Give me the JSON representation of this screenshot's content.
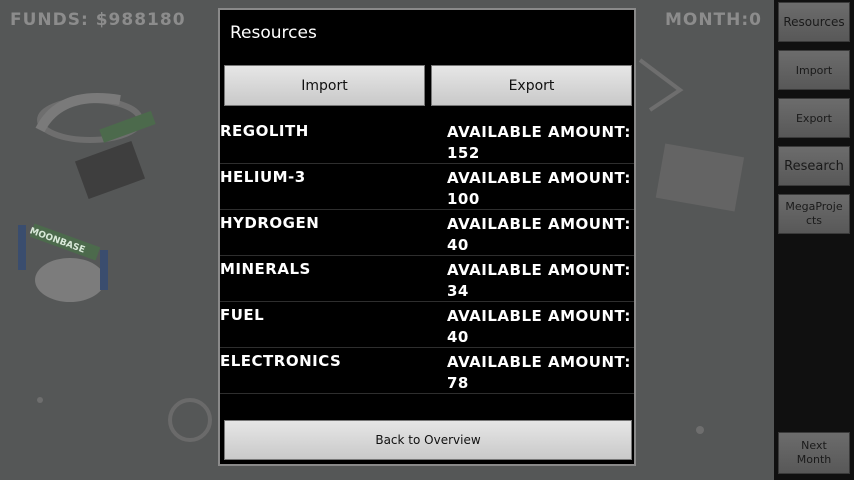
{
  "hud": {
    "funds": "FUNDS: $988180",
    "month": "MONTH:0"
  },
  "sidebar": {
    "resources": "Resources",
    "import": "Import",
    "export": "Export",
    "research": "Research",
    "megaprojects": "MegaProje\ncts",
    "next_month": "Next\nMonth"
  },
  "map": {
    "moonbase_label": "MOONBASE"
  },
  "dialog": {
    "title": "Resources",
    "import_label": "Import",
    "export_label": "Export",
    "amount_label": "AVAILABLE AMOUNT:",
    "back_label": "Back to Overview",
    "resources": [
      {
        "name": "REGOLITH",
        "amount": "152"
      },
      {
        "name": "HELIUM-3",
        "amount": "100"
      },
      {
        "name": "HYDROGEN",
        "amount": "40"
      },
      {
        "name": "MINERALS",
        "amount": "34"
      },
      {
        "name": "FUEL",
        "amount": "40"
      },
      {
        "name": "ELECTRONICS",
        "amount": "78"
      }
    ]
  }
}
